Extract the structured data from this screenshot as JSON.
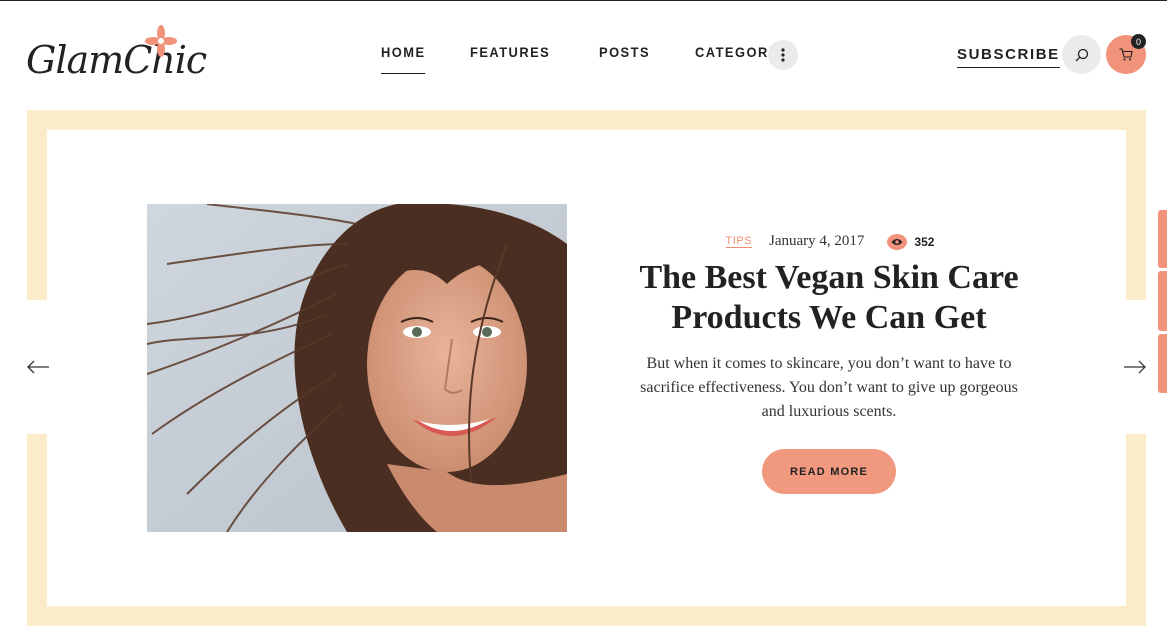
{
  "header": {
    "logo_text": "GlamChic",
    "nav": [
      {
        "label": "HOME",
        "active": true
      },
      {
        "label": "FEATURES",
        "active": false
      },
      {
        "label": "POSTS",
        "active": false
      },
      {
        "label": "CATEGORIES",
        "active": false
      }
    ],
    "more_icon": "vertical-dots-icon",
    "subscribe_label": "SUBSCRIBE",
    "search_icon": "search-icon",
    "cart_icon": "cart-icon",
    "cart_count": "0"
  },
  "slide": {
    "category": "TIPS",
    "date": "January 4, 2017",
    "views": "352",
    "title": "The Best Vegan Skin Care Products We Can Get",
    "excerpt": "But when it comes to skincare, you don’t want to have to sacrifice effectiveness. You don’t want to give up gorgeous and luxurious scents.",
    "read_more_label": "READ MORE"
  },
  "colors": {
    "accent": "#f0937a",
    "frame": "#fcebc9",
    "text": "#222222"
  }
}
